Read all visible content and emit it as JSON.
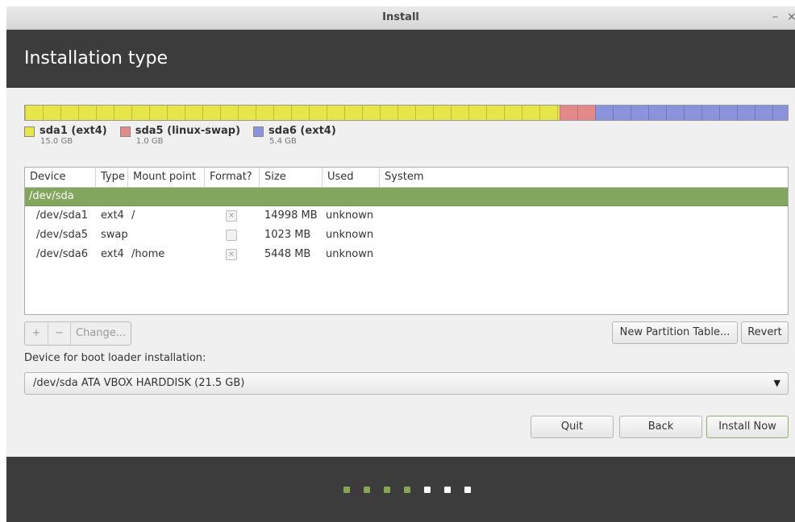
{
  "window": {
    "title": "Install",
    "minimize_glyph": "–",
    "close_glyph": "×"
  },
  "header": {
    "title": "Installation type"
  },
  "partition_bar": {
    "segments": [
      {
        "name": "sda1",
        "color": "#e6e64a",
        "size_gb": 15.0
      },
      {
        "name": "sda5",
        "color": "#e48a8a",
        "size_gb": 1.0
      },
      {
        "name": "sda6",
        "color": "#8c93dd",
        "size_gb": 5.4
      }
    ]
  },
  "legend": [
    {
      "label": "sda1 (ext4)",
      "size": "15.0 GB",
      "color": "#e6e64a"
    },
    {
      "label": "sda5 (linux-swap)",
      "size": "1.0 GB",
      "color": "#e48a8a"
    },
    {
      "label": "sda6 (ext4)",
      "size": "5.4 GB",
      "color": "#8c93dd"
    }
  ],
  "table": {
    "headers": [
      "Device",
      "Type",
      "Mount point",
      "Format?",
      "Size",
      "Used",
      "System"
    ],
    "device": "/dev/sda",
    "rows": [
      {
        "device": "/dev/sda1",
        "type": "ext4",
        "mount": "/",
        "format": true,
        "size": "14998 MB",
        "used": "unknown",
        "system": ""
      },
      {
        "device": "/dev/sda5",
        "type": "swap",
        "mount": "",
        "format": false,
        "size": "1023 MB",
        "used": "unknown",
        "system": ""
      },
      {
        "device": "/dev/sda6",
        "type": "ext4",
        "mount": "/home",
        "format": true,
        "size": "5448 MB",
        "used": "unknown",
        "system": ""
      }
    ]
  },
  "toolbar": {
    "add": "+",
    "remove": "−",
    "change": "Change..."
  },
  "buttons": {
    "new_partition_table": "New Partition Table...",
    "revert": "Revert",
    "quit": "Quit",
    "back": "Back",
    "install_now": "Install Now"
  },
  "boot_loader": {
    "label": "Device for boot loader installation:",
    "value": "/dev/sda   ATA VBOX HARDDISK (21.5 GB)"
  },
  "progress": {
    "total_steps": 7,
    "completed_steps": 4
  },
  "colors": {
    "header_bg": "#3c3c3c",
    "selected_row": "#83a65e",
    "step_done": "#87a556",
    "step_todo": "#ffffff"
  }
}
